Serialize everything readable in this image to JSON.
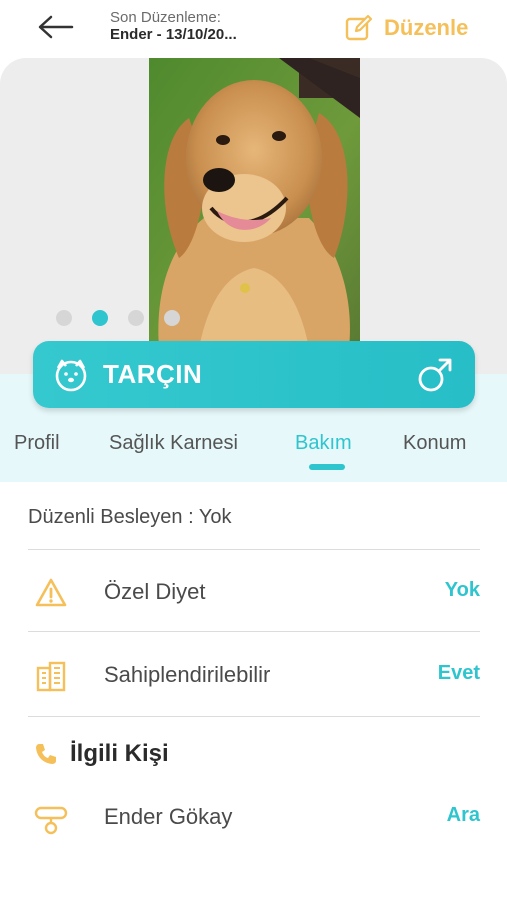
{
  "header": {
    "back_icon": "arrow-left-icon",
    "last_edit_label": "Son Düzenleme:",
    "last_edit_value": "Ender - 13/10/20...",
    "edit_label": "Düzenle",
    "edit_icon": "edit-icon"
  },
  "hero": {
    "carousel_count": 4,
    "carousel_active_index": 1
  },
  "pet": {
    "name": "TARÇIN",
    "pet_icon": "dog-face-icon",
    "gender_icon": "male-symbol-icon"
  },
  "tabs": [
    {
      "label": "Profil"
    },
    {
      "label": "Sağlık Karnesi"
    },
    {
      "label": "Bakım"
    },
    {
      "label": "Konum"
    }
  ],
  "active_tab": "Bakım",
  "care": {
    "regular_feeder": "Düzenli Besleyen : Yok",
    "items": [
      {
        "label": "Özel Diyet",
        "value": "Yok",
        "icon": "warning-icon"
      },
      {
        "label": "Sahiplendirilebilir",
        "value": "Evet",
        "icon": "building-icon"
      }
    ],
    "contact_title": "İlgili Kişi",
    "contact_icon": "phone-icon",
    "contact": {
      "label": "Ender Gökay",
      "value": "Ara",
      "icon": "collar-icon"
    }
  },
  "colors": {
    "accent": "#2ec5cf",
    "edit_accent": "#f5c05a",
    "band": "#e6f8fa"
  }
}
